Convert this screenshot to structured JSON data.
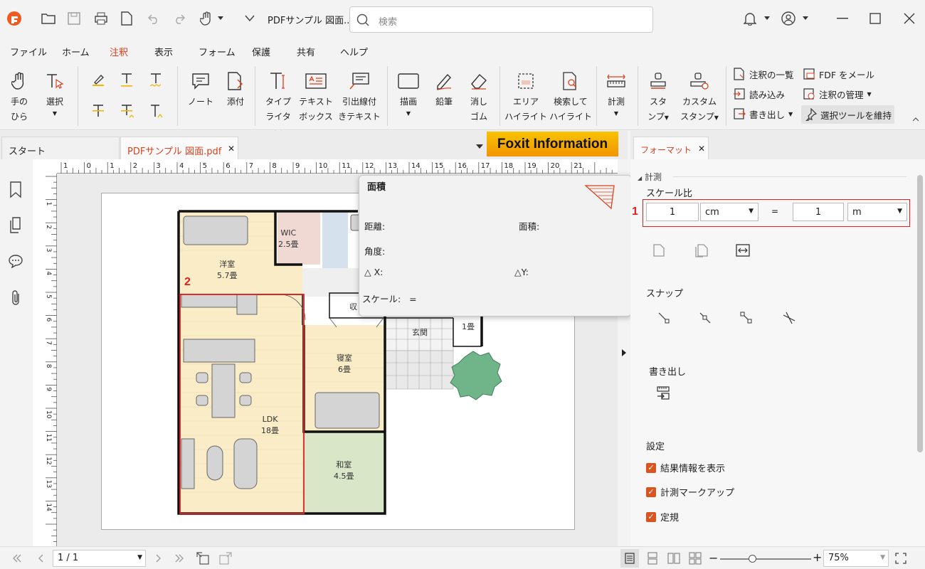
{
  "titlebar": {
    "doc_name": "PDFサンプル 図面....",
    "search_placeholder": "検索"
  },
  "menus": [
    "ファイル",
    "ホーム",
    "注釈",
    "表示",
    "フォーム",
    "保護",
    "共有",
    "ヘルプ"
  ],
  "ribbon": {
    "hand": [
      "手の",
      "ひら"
    ],
    "select": "選択",
    "note": "ノート",
    "attach": "添付",
    "typewriter": [
      "タイプ",
      "ライター"
    ],
    "textbox": [
      "テキスト",
      "ボックス"
    ],
    "callout": [
      "引出線付",
      "きテキスト"
    ],
    "draw": "描画",
    "pencil": "鉛筆",
    "eraser": [
      "消し",
      "ゴム"
    ],
    "area_highlight": [
      "エリア",
      "ハイライト"
    ],
    "search_highlight": [
      "検索して",
      "ハイライト"
    ],
    "measure": "計測",
    "stamp": [
      "スタ",
      "ンプ"
    ],
    "custom_stamp": [
      "カスタム",
      "スタンプ"
    ],
    "comment_list": "注釈の一覧",
    "import": "読み込み",
    "export": "書き出し",
    "fdf_mail": "FDF をメール",
    "manage_comments": "注釈の管理",
    "keep_tool": "選択ツールを維持"
  },
  "tabs": {
    "start": "スタート",
    "doc": "PDFサンプル 図面.pdf",
    "banner": "Foxit Information",
    "format": "フォーマット"
  },
  "ruler_numbers": [
    "1",
    "0",
    "1",
    "2",
    "3",
    "4",
    "5",
    "6",
    "7",
    "8",
    "9",
    "10",
    "11",
    "12",
    "13",
    "14",
    "15",
    "16",
    "17",
    "18",
    "19",
    "20",
    "21"
  ],
  "ruler_v_numbers": [
    "1",
    "2",
    "3",
    "4",
    "5",
    "6",
    "7",
    "8",
    "9",
    "10",
    "11",
    "12",
    "13",
    "14"
  ],
  "rooms": {
    "wic": [
      "WIC",
      "2.5畳"
    ],
    "youshitsu": [
      "洋室",
      "5.7畳"
    ],
    "ldk": [
      "LDK",
      "18畳"
    ],
    "shinshitsu": [
      "寝室",
      "6畳"
    ],
    "washitsu": [
      "和室",
      "4.5畳"
    ],
    "genkan": "玄関",
    "shuno": "収",
    "one_jo": "1畳"
  },
  "annotations": {
    "one": "1",
    "two": "2"
  },
  "popup": {
    "title": "面積",
    "distance": "距離:",
    "area": "面積:",
    "angle": "角度:",
    "dx": "X:",
    "dy": "Y:",
    "scale": "スケール:",
    "scale_eq": "="
  },
  "panel": {
    "section_measure": "計測",
    "scale_ratio": "スケール比",
    "scale_from": "1",
    "unit_from": "cm",
    "equals": "=",
    "scale_to": "1",
    "unit_to": "m",
    "snap": "スナップ",
    "export": "書き出し",
    "settings": "設定",
    "chk_result": "結果情報を表示",
    "chk_markup": "計測マークアップ",
    "chk_ruler": "定規"
  },
  "status": {
    "page": "1 / 1",
    "zoom": "75%"
  },
  "colors": {
    "accent": "#d9411e",
    "highlight_red": "#e02020",
    "banner_bg": "#f5a800"
  }
}
